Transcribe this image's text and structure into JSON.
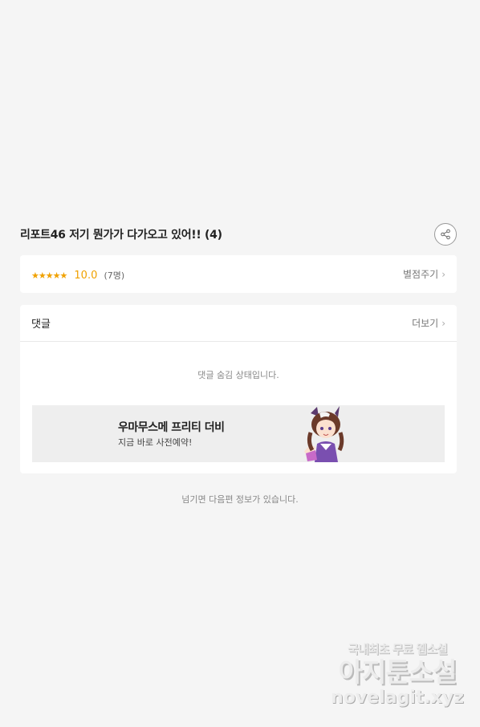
{
  "episode": {
    "title": "리포트46 저기 뭔가가 다가오고 있어!! (4)"
  },
  "rating": {
    "stars": "★★★★★",
    "value": "10.0",
    "count": "(7명)",
    "rate_button": "별점주기"
  },
  "comments": {
    "title": "댓글",
    "more_button": "더보기",
    "hidden_message": "댓글 숨김 상태입니다."
  },
  "ad": {
    "title": "우마무스메 프리티 더비",
    "subtitle": "지금 바로 사전예약!"
  },
  "footer": {
    "next_info": "넘기면 다음편 정보가 있습니다."
  },
  "watermark": {
    "line1": "국내최초 무료 웹소설",
    "line2": "아지툰소설",
    "line3": "novelagit.xyz"
  },
  "colors": {
    "accent": "#f0a100",
    "background": "#f5f5f5",
    "card": "#ffffff"
  }
}
